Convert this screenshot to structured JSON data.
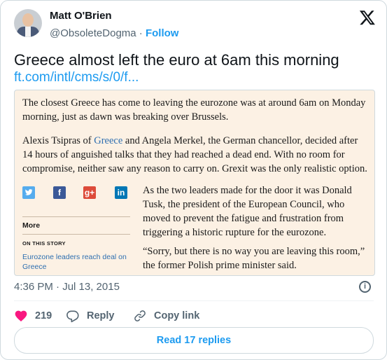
{
  "author": {
    "name": "Matt O'Brien",
    "handle": "@ObsoleteDogma",
    "separator": "·",
    "follow_label": "Follow"
  },
  "tweet": {
    "text": "Greece almost left the euro at 6am this morning",
    "link": "ft.com/intl/cms/s/0/f..."
  },
  "article": {
    "paragraph1": "The closest Greece has come to leaving the eurozone was at around 6am on Monday morning, just as dawn was breaking over Brussels.",
    "paragraph2_before": "Alexis Tsipras of ",
    "paragraph2_link": "Greece",
    "paragraph2_after": " and Angela Merkel, the German chancellor, decided after 14 hours of anguished talks that they had reached a dead end. With no room for compromise, neither saw any reason to carry on. Grexit was the only realistic option.",
    "paragraph3": "As the two leaders made for the door it was Donald Tusk, the president of the European Council, who moved to prevent the fatigue and frustration from triggering a historic rupture for the eurozone.",
    "paragraph4": "“Sorry, but there is no way you are leaving this room,” the former Polish prime minister said.",
    "share_icons": [
      "twitter-icon",
      "facebook-icon",
      "google-plus-icon",
      "linkedin-icon"
    ],
    "share_glyphs": {
      "facebook": "f",
      "google_plus": "g+",
      "linkedin": "in"
    },
    "more_label": "More",
    "on_this_story_label": "ON THIS STORY",
    "story_link": "Eurozone leaders reach deal on Greece"
  },
  "timestamp": "4:36 PM · Jul 13, 2015",
  "actions": {
    "like_count": "219",
    "reply_label": "Reply",
    "copy_link_label": "Copy link"
  },
  "read_replies_label": "Read 17 replies",
  "colors": {
    "accent": "#1d9bf0",
    "like": "#f91880",
    "article_bg": "#fcf1e4",
    "text_secondary": "#536471"
  }
}
